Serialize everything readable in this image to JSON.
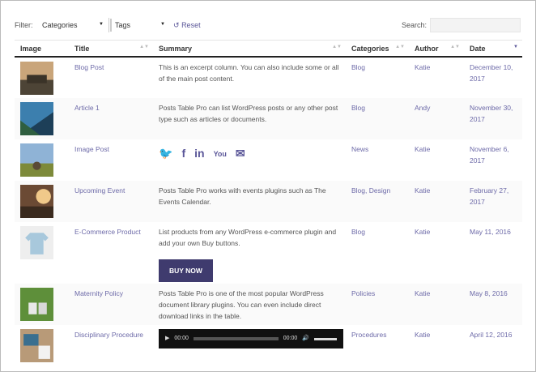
{
  "toolbar": {
    "filter_label": "Filter:",
    "categories_select": "Categories",
    "tags_select": "Tags",
    "reset_label": "Reset",
    "search_label": "Search:"
  },
  "columns": [
    "Image",
    "Title",
    "Summary",
    "Categories",
    "Author",
    "Date"
  ],
  "rows": [
    {
      "title": "Blog Post",
      "summary": "This is an excerpt column. You can also include some or all of the main post content.",
      "categories": "Blog",
      "author": "Katie",
      "date": "December 10, 2017",
      "thumb": "pier"
    },
    {
      "title": "Article 1",
      "summary": "Posts Table Pro can list WordPress posts or any other post type such as articles or documents.",
      "categories": "Blog",
      "author": "Andy",
      "date": "November 30, 2017",
      "thumb": "lake"
    },
    {
      "title": "Image Post",
      "summary": "",
      "categories": "News",
      "author": "Katie",
      "date": "November 6, 2017",
      "thumb": "field"
    },
    {
      "title": "Upcoming Event",
      "summary": "Posts Table Pro works with events plugins such as The Events Calendar.",
      "categories": "Blog, Design",
      "author": "Katie",
      "date": "February 27, 2017",
      "thumb": "sunset"
    },
    {
      "title": "E-Commerce Product",
      "summary": "List products from any WordPress e-commerce plugin and add your own Buy buttons.",
      "categories": "Blog",
      "author": "Katie",
      "date": "May 11, 2016",
      "thumb": "tshirt"
    },
    {
      "title": "Maternity Policy",
      "summary": "Posts Table Pro is one of the most popular WordPress document library plugins. You can even include direct download links in the table.",
      "categories": "Policies",
      "author": "Katie",
      "date": "May 8, 2016",
      "thumb": "shoes"
    },
    {
      "title": "Disciplinary Procedure",
      "summary": "",
      "categories": "Procedures",
      "author": "Katie",
      "date": "April 12, 2016",
      "thumb": "desk"
    }
  ],
  "social_icons": [
    "twitter-icon",
    "facebook-icon",
    "linkedin-icon",
    "youtube-icon",
    "email-icon"
  ],
  "buy_now_label": "BUY NOW",
  "player": {
    "current_time": "00:00",
    "duration": "00:00"
  },
  "colors": {
    "accent": "#5b5799",
    "button": "#3f3b6e"
  }
}
